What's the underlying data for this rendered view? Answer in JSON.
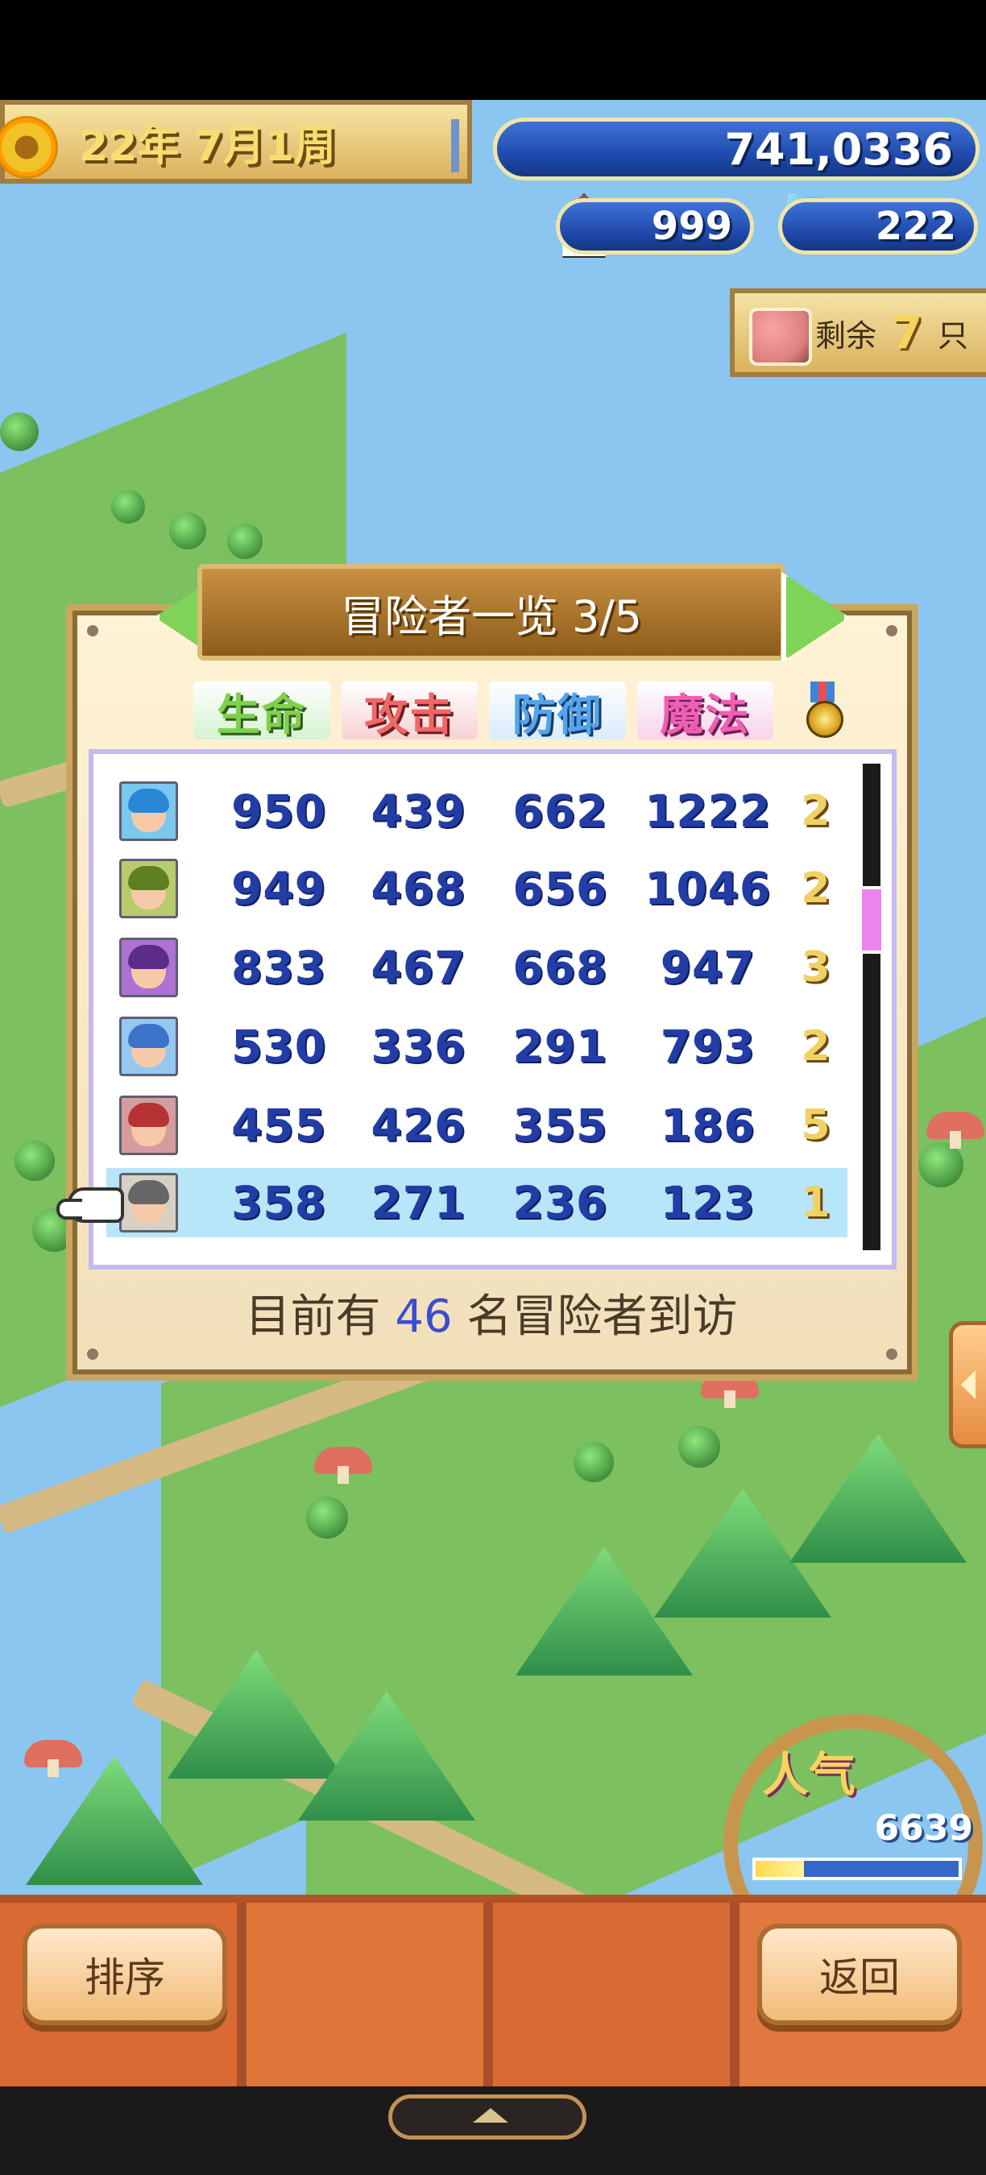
{
  "header": {
    "date": "22年 7月1周",
    "gold": "741,0336",
    "houses": "999",
    "crystals": "222"
  },
  "remaining": {
    "prefix": "剩余",
    "value": "7",
    "suffix": "只"
  },
  "panel": {
    "title": "冒险者一览 3/5",
    "columns": [
      "生命",
      "攻击",
      "防御",
      "魔法"
    ],
    "rows": [
      {
        "life": "950",
        "attack": "439",
        "defense": "662",
        "magic": "1222",
        "rank": "2"
      },
      {
        "life": "949",
        "attack": "468",
        "defense": "656",
        "magic": "1046",
        "rank": "2"
      },
      {
        "life": "833",
        "attack": "467",
        "defense": "668",
        "magic": "947",
        "rank": "3"
      },
      {
        "life": "530",
        "attack": "336",
        "defense": "291",
        "magic": "793",
        "rank": "2"
      },
      {
        "life": "455",
        "attack": "426",
        "defense": "355",
        "magic": "186",
        "rank": "5"
      },
      {
        "life": "358",
        "attack": "271",
        "defense": "236",
        "magic": "123",
        "rank": "1"
      }
    ],
    "visitors_prefix": "目前有",
    "visitors_count": "46",
    "visitors_suffix": "名冒险者到访"
  },
  "popularity": {
    "label": "人气",
    "value": "6639",
    "progress": 0.24
  },
  "buttons": {
    "sort": "排序",
    "back": "返回"
  },
  "colors": {
    "sky": "#8ac6ef",
    "panel_border": "#c9a660",
    "selected_row": "#b7e6f8",
    "number_blue": "#233da6"
  },
  "icons": [
    "sun-icon",
    "coin-icon",
    "house-icon",
    "crystal-icon",
    "pig-icon",
    "medal-icon",
    "hand-pointer-icon"
  ]
}
